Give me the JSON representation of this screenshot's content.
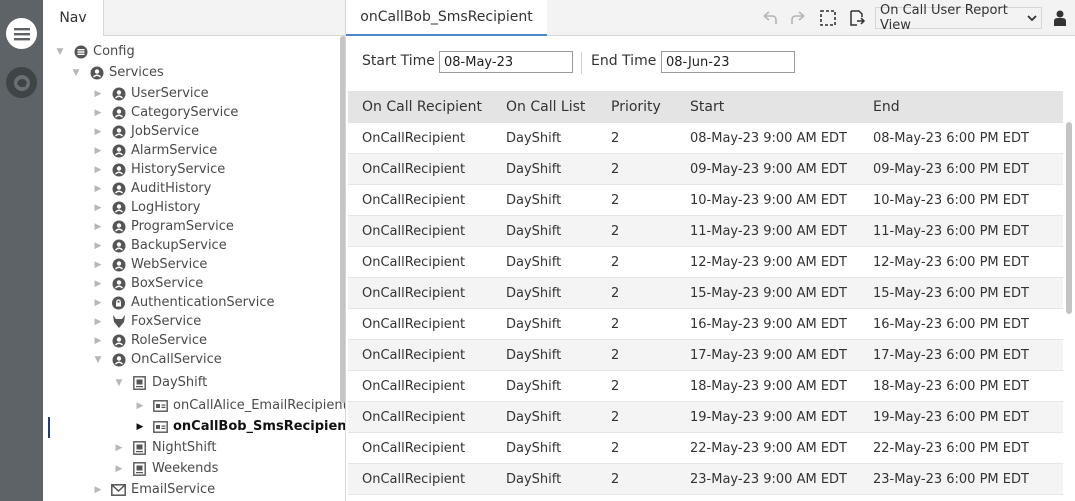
{
  "colors": {
    "rail": "#5e6367",
    "accent_tab": "#4a89c8",
    "selection_mark": "#233a7d",
    "header_bg": "#e4e4e4"
  },
  "rail": {
    "menu_icon": "hamburger-icon",
    "home_icon": "home-icon"
  },
  "nav": {
    "tab_label": "Nav",
    "tree": [
      {
        "label": "Config",
        "icon": "config-icon"
      },
      {
        "label": "Services",
        "icon": "services-icon"
      },
      {
        "label": "UserService",
        "icon": "user-icon"
      },
      {
        "label": "CategoryService",
        "icon": "category-icon"
      },
      {
        "label": "JobService",
        "icon": "job-icon"
      },
      {
        "label": "AlarmService",
        "icon": "alarm-icon"
      },
      {
        "label": "HistoryService",
        "icon": "history-icon"
      },
      {
        "label": "AuditHistory",
        "icon": "audit-icon"
      },
      {
        "label": "LogHistory",
        "icon": "log-icon"
      },
      {
        "label": "ProgramService",
        "icon": "program-icon"
      },
      {
        "label": "BackupService",
        "icon": "backup-icon"
      },
      {
        "label": "WebService",
        "icon": "web-icon"
      },
      {
        "label": "BoxService",
        "icon": "box-icon"
      },
      {
        "label": "AuthenticationService",
        "icon": "lock-icon"
      },
      {
        "label": "FoxService",
        "icon": "fox-icon"
      },
      {
        "label": "RoleService",
        "icon": "role-icon"
      },
      {
        "label": "OnCallService",
        "icon": "oncall-icon"
      },
      {
        "label": "DayShift",
        "icon": "schedule-icon"
      },
      {
        "label": "onCallAlice_EmailRecipient",
        "icon": "recipient-icon"
      },
      {
        "label": "onCallBob_SmsRecipient",
        "icon": "recipient-icon"
      },
      {
        "label": "NightShift",
        "icon": "schedule-icon"
      },
      {
        "label": "Weekends",
        "icon": "schedule-icon"
      },
      {
        "label": "EmailService",
        "icon": "email-icon"
      }
    ]
  },
  "main": {
    "tab_label": "onCallBob_SmsRecipient",
    "toolbar": {
      "undo_icon": "undo-icon",
      "redo_icon": "redo-icon",
      "select_icon": "marquee-select-icon",
      "export_icon": "export-icon",
      "view_selector": "On Call User Report View",
      "user_icon": "user-icon"
    },
    "filter": {
      "start_label": "Start Time",
      "start_value": "08-May-23",
      "end_label": "End Time",
      "end_value": "08-Jun-23"
    },
    "table": {
      "columns": [
        "On Call Recipient",
        "On Call List",
        "Priority",
        "Start",
        "End"
      ],
      "rows": [
        [
          "OnCallRecipient",
          "DayShift",
          "2",
          "08-May-23 9:00 AM EDT",
          "08-May-23 6:00 PM EDT"
        ],
        [
          "OnCallRecipient",
          "DayShift",
          "2",
          "09-May-23 9:00 AM EDT",
          "09-May-23 6:00 PM EDT"
        ],
        [
          "OnCallRecipient",
          "DayShift",
          "2",
          "10-May-23 9:00 AM EDT",
          "10-May-23 6:00 PM EDT"
        ],
        [
          "OnCallRecipient",
          "DayShift",
          "2",
          "11-May-23 9:00 AM EDT",
          "11-May-23 6:00 PM EDT"
        ],
        [
          "OnCallRecipient",
          "DayShift",
          "2",
          "12-May-23 9:00 AM EDT",
          "12-May-23 6:00 PM EDT"
        ],
        [
          "OnCallRecipient",
          "DayShift",
          "2",
          "15-May-23 9:00 AM EDT",
          "15-May-23 6:00 PM EDT"
        ],
        [
          "OnCallRecipient",
          "DayShift",
          "2",
          "16-May-23 9:00 AM EDT",
          "16-May-23 6:00 PM EDT"
        ],
        [
          "OnCallRecipient",
          "DayShift",
          "2",
          "17-May-23 9:00 AM EDT",
          "17-May-23 6:00 PM EDT"
        ],
        [
          "OnCallRecipient",
          "DayShift",
          "2",
          "18-May-23 9:00 AM EDT",
          "18-May-23 6:00 PM EDT"
        ],
        [
          "OnCallRecipient",
          "DayShift",
          "2",
          "19-May-23 9:00 AM EDT",
          "19-May-23 6:00 PM EDT"
        ],
        [
          "OnCallRecipient",
          "DayShift",
          "2",
          "22-May-23 9:00 AM EDT",
          "22-May-23 6:00 PM EDT"
        ],
        [
          "OnCallRecipient",
          "DayShift",
          "2",
          "23-May-23 9:00 AM EDT",
          "23-May-23 6:00 PM EDT"
        ]
      ]
    }
  }
}
